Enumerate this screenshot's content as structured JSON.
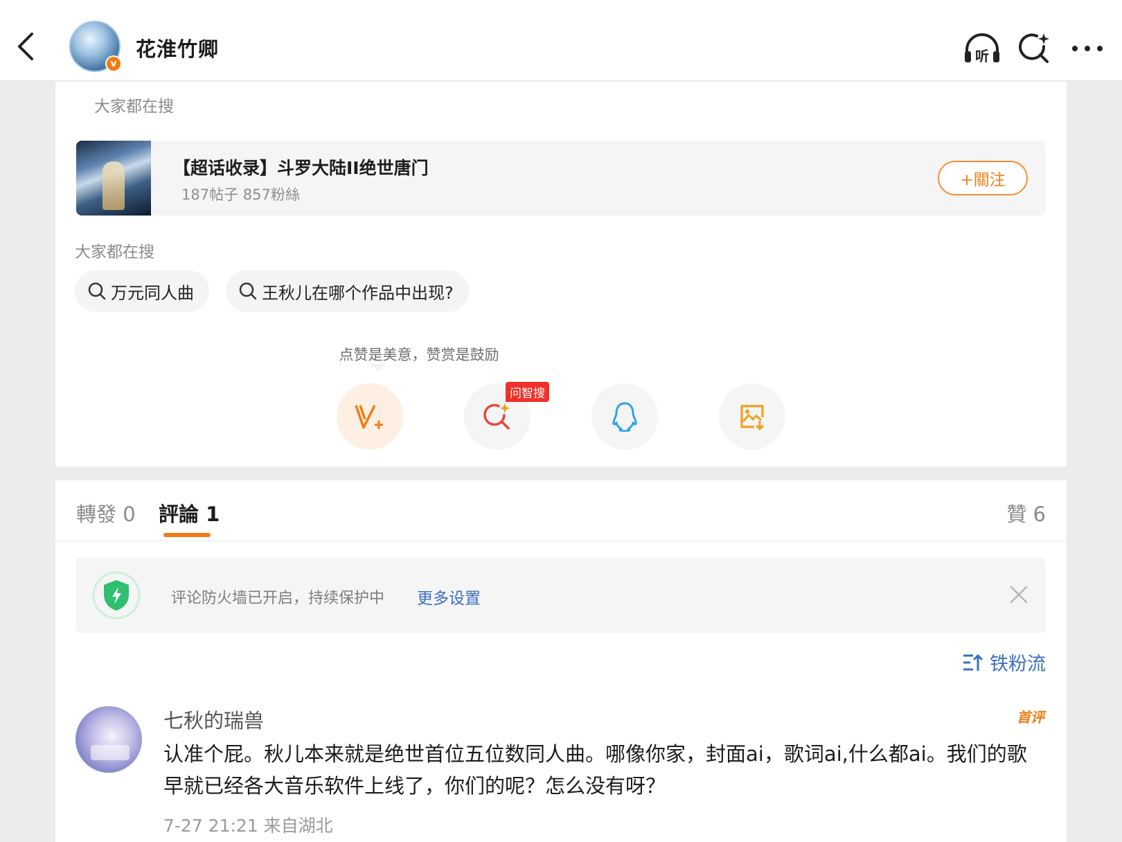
{
  "header": {
    "username": "花淮竹卿",
    "badge": "v",
    "icons": [
      "back-icon",
      "listen-icon",
      "ai-search-icon",
      "more-icon"
    ],
    "listen_label": "听"
  },
  "post": {
    "search_hint": "大家都在搜",
    "topic": {
      "title": "【超话收录】斗罗大陆II绝世唐门",
      "stats": "187帖子 857粉絲",
      "follow_label": "+關注"
    },
    "search_hint2": "大家都在搜",
    "search_chips": [
      "万元同人曲",
      "王秋儿在哪个作品中出现?"
    ],
    "tip": "点赞是美意，赞赏是鼓励",
    "ask_badge": "问智搜"
  },
  "tabs": {
    "repost": "轉發 0",
    "comment": "評論 1",
    "like": "贊 6"
  },
  "firewall": {
    "text": "评论防火墙已开启，持续保护中",
    "link": "更多设置"
  },
  "sort_label": "铁粉流",
  "comment": {
    "name": "七秋的瑞兽",
    "badge": "首评",
    "text": "认准个屁。秋儿本来就是绝世首位五位数同人曲。哪像你家，封面ai，歌词ai,什么都ai。我们的歌早就已经各大音乐软件上线了，你们的呢？怎么没有呀？",
    "meta": "7-27 21:21 来自湖北"
  },
  "colors": {
    "accent": "#f27b14",
    "link": "#3a6ec0",
    "shield": "#2fbf71",
    "ai_red": "#e8453c"
  }
}
